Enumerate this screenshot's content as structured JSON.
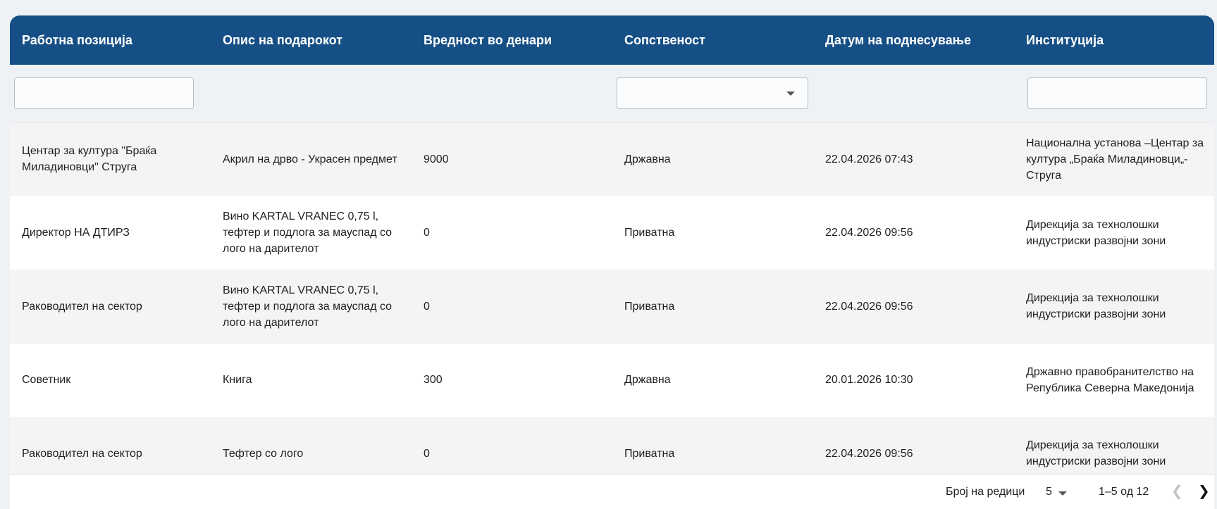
{
  "table": {
    "headers": [
      "Работна позиција",
      "Опис на подарокот",
      "Вредност во денари",
      "Сопственост",
      "Датум на поднесување",
      "Институција"
    ],
    "rows": [
      {
        "position": "Центар за култура \"Браќа Миладиновци\" Струга",
        "description": "Акрил на дрво - Украсен предмет",
        "value": "9000",
        "ownership": "Државна",
        "date": "22.04.2026 07:43",
        "institution": "Национална установа –Центар за култура „Браќа Миладиновци„-Струга"
      },
      {
        "position": "Директор НА ДТИРЗ",
        "description": "Вино KARTAL VRANEC 0,75 l, тефтер и подлога за мауспад со лого на дарителот",
        "value": "0",
        "ownership": "Приватна",
        "date": "22.04.2026 09:56",
        "institution": "Дирекција за технолошки индустриски развојни зони"
      },
      {
        "position": "Раководител на сектор",
        "description": "Вино KARTAL VRANEC 0,75 l, тефтер и подлога за мауспад со лого на дарителот",
        "value": "0",
        "ownership": "Приватна",
        "date": "22.04.2026 09:56",
        "institution": "Дирекција за технолошки индустриски развојни зони"
      },
      {
        "position": "Советник",
        "description": "Книга",
        "value": "300",
        "ownership": "Државна",
        "date": "20.01.2026 10:30",
        "institution": "Државно правобранителство на Република Северна Македонија"
      },
      {
        "position": "Раководител на сектор",
        "description": "Тефтер со лого",
        "value": "0",
        "ownership": "Приватна",
        "date": "22.04.2026 09:56",
        "institution": "Дирекција за технолошки индустриски развојни зони"
      }
    ]
  },
  "pagination": {
    "rows_per_page_label": "Број на редици",
    "rows_per_page_value": "5",
    "range_text": "1–5 од 12",
    "prev_icon": "chevron-left-icon",
    "next_icon": "chevron-right-icon"
  },
  "colors": {
    "header_bg": "#154f85",
    "header_text": "#ffffff",
    "stripe_bg": "#f4f4f4"
  }
}
